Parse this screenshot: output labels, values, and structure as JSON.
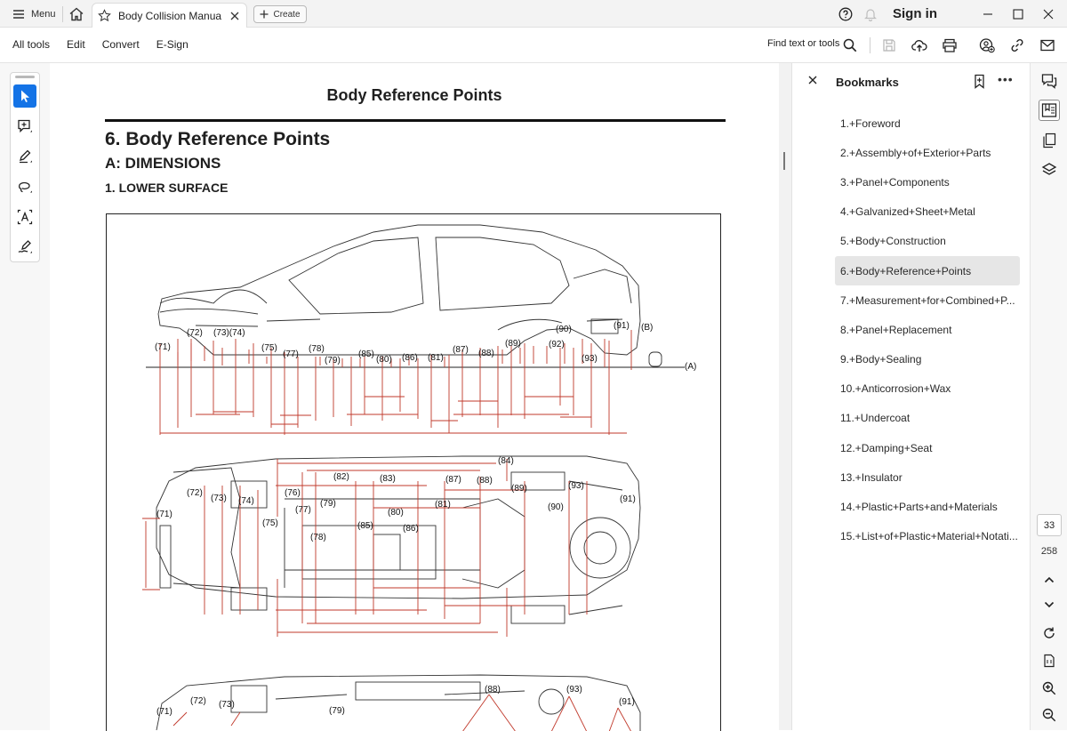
{
  "titlebar": {
    "menu_label": "Menu",
    "tab_title": "Body Collision Manual.p...",
    "create_label": "Create",
    "signin_label": "Sign in"
  },
  "toolbar": {
    "menu_items": [
      "All tools",
      "Edit",
      "Convert",
      "E-Sign"
    ],
    "find_label": "Find text or tools"
  },
  "document": {
    "header_title": "Body Reference Points",
    "section_title": "6.  Body Reference Points",
    "subsection_title": "A:  DIMENSIONS",
    "sub_subsection_title": "1.  LOWER SURFACE",
    "figure": {
      "side_view_labels": [
        "(71)",
        "(72)",
        "(73)(74)",
        "(75)",
        "(77)",
        "(78)",
        "(79)",
        "(85)",
        "(80)",
        "(86)",
        "(81)",
        "(87)",
        "(88)",
        "(89)",
        "(90)",
        "(92)",
        "(93)",
        "(91)",
        "(B)",
        "(A)"
      ],
      "top_view_labels": [
        "(84)",
        "(82)",
        "(83)",
        "(87)",
        "(88)",
        "(89)",
        "(93)",
        "(72)",
        "(73)",
        "(74)",
        "(76)",
        "(79)",
        "(91)",
        "(90)",
        "(77)",
        "(80)",
        "(81)",
        "(71)",
        "(75)",
        "(78)",
        "(85)",
        "(86)"
      ],
      "lower_view_labels": [
        "(88)",
        "(93)",
        "(72)",
        "(73)",
        "(79)",
        "(91)",
        "(71)"
      ]
    }
  },
  "bookmarks": {
    "title": "Bookmarks",
    "selected_index": 5,
    "items": [
      "1.+Foreword",
      "2.+Assembly+of+Exterior+Parts",
      "3.+Panel+Components",
      "4.+Galvanized+Sheet+Metal",
      "5.+Body+Construction",
      "6.+Body+Reference+Points",
      "7.+Measurement+for+Combined+P...",
      "8.+Panel+Replacement",
      "9.+Body+Sealing",
      "10.+Anticorrosion+Wax",
      "11.+Undercoat",
      "12.+Damping+Seat",
      "13.+Insulator",
      "14.+Plastic+Parts+and+Materials",
      "15.+List+of+Plastic+Material+Notati..."
    ]
  },
  "navigation": {
    "current_page": "33",
    "total_pages": "258"
  },
  "colors": {
    "accent": "#1473e6",
    "dimension_lines": "#c0392b"
  }
}
